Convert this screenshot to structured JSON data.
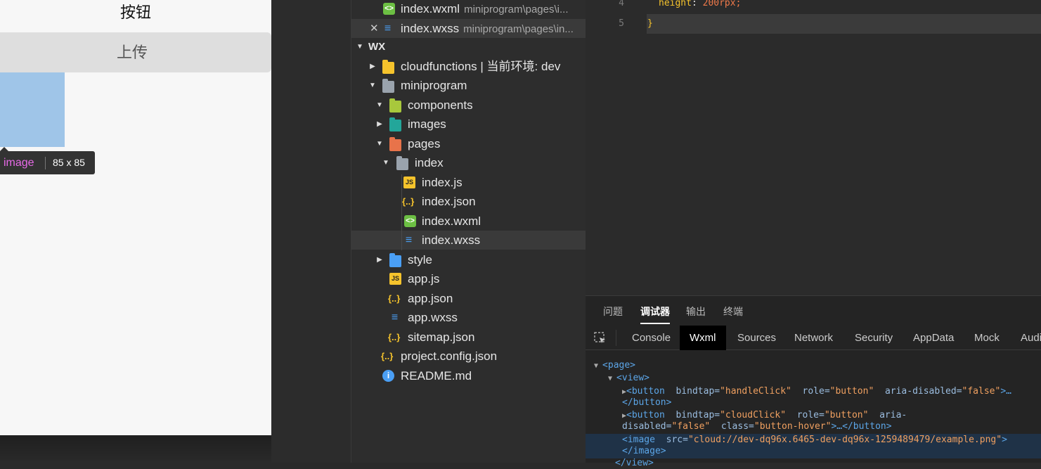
{
  "simulator": {
    "button1": "按钮",
    "button2": "上传",
    "tooltip": {
      "tag": "image",
      "size": "85 x 85"
    }
  },
  "explorer": {
    "open_files": [
      {
        "name": "index.wxml",
        "path": "miniprogram\\pages\\i...",
        "icon": "wxml-icon"
      },
      {
        "name": "index.wxss",
        "path": "miniprogram\\pages\\in...",
        "icon": "wxss-icon",
        "close": "✕"
      }
    ],
    "project": "WX",
    "tree": [
      {
        "label": "cloudfunctions | 当前环境: dev",
        "icon": "cloud-folder-icon"
      },
      {
        "label": "miniprogram",
        "icon": "folder-icon"
      },
      {
        "label": "components",
        "icon": "folder-icon"
      },
      {
        "label": "images",
        "icon": "folder-icon"
      },
      {
        "label": "pages",
        "icon": "folder-icon"
      },
      {
        "label": "index",
        "icon": "folder-icon"
      },
      {
        "label": "index.js",
        "icon": "js-icon"
      },
      {
        "label": "index.json",
        "icon": "json-icon"
      },
      {
        "label": "index.wxml",
        "icon": "wxml-icon"
      },
      {
        "label": "index.wxss",
        "icon": "wxss-icon"
      },
      {
        "label": "style",
        "icon": "folder-icon"
      },
      {
        "label": "app.js",
        "icon": "js-icon"
      },
      {
        "label": "app.json",
        "icon": "json-icon"
      },
      {
        "label": "app.wxss",
        "icon": "wxss-icon"
      },
      {
        "label": "sitemap.json",
        "icon": "json-icon"
      },
      {
        "label": "project.config.json",
        "icon": "json-icon"
      },
      {
        "label": "README.md",
        "icon": "info-icon"
      }
    ]
  },
  "editor": {
    "line4": {
      "number": "4",
      "prop": "height",
      "colon": ": ",
      "num": "200",
      "unit": "rpx;"
    },
    "line5": {
      "number": "5",
      "text": "}"
    }
  },
  "devtools": {
    "top_tabs": [
      "问题",
      "调试器",
      "输出",
      "终端"
    ],
    "active_top_tab": "调试器",
    "tabs": [
      "Console",
      "Wxml",
      "Sources",
      "Network",
      "Security",
      "AppData",
      "Mock",
      "Audi"
    ],
    "active_tab": "Wxml",
    "wxml": {
      "page_open": "<page>",
      "view_open": "<view>",
      "btn1_tag": "<button",
      "btn1_attrs": [
        {
          "name": "bindtap",
          "value": "\"handleClick\""
        },
        {
          "name": "role",
          "value": "\"button\""
        },
        {
          "name": "aria-disabled",
          "value": "\"false\""
        }
      ],
      "btn1_tail": ">…",
      "btn_close": "</button>",
      "btn2_tag": "<button",
      "btn2_attrs": [
        {
          "name": "bindtap",
          "value": "\"cloudClick\""
        },
        {
          "name": "role",
          "value": "\"button\""
        }
      ],
      "btn2_aria": "aria-",
      "btn2_line2_name": "disabled=",
      "btn2_line2_val": "\"false\"",
      "btn2_class_name": "class=",
      "btn2_class_val": "\"button-hover\"",
      "btn2_tail": ">…</button>",
      "image_tag": "<image",
      "image_src_name": "src=",
      "image_src_val": "\"cloud://dev-dq96x.6465-dev-dq96x-1259489479/example.png\"",
      "image_gt": ">",
      "image_close": "</image>",
      "view_close": "</view>"
    }
  }
}
